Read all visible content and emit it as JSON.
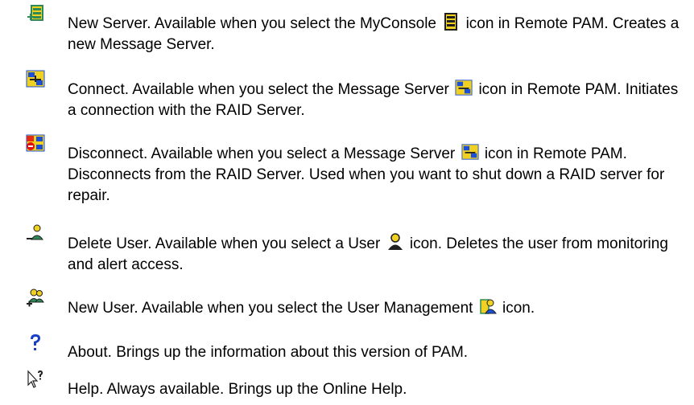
{
  "entries": [
    {
      "icon": "new-server-icon",
      "pre": "New Server. Available when you select the MyConsole",
      "inline_icon": "myconsole-icon",
      "post": "icon in Remote PAM. Creates a new Message Server."
    },
    {
      "icon": "connect-icon",
      "pre": "Connect. Available when you select the Message Server",
      "inline_icon": "message-server-icon",
      "post": "icon in Remote PAM. Initiates a connection with the RAID Server."
    },
    {
      "icon": "disconnect-icon",
      "pre": "Disconnect. Available when you select a Message Server",
      "inline_icon": "message-server-icon",
      "post": "icon in Remote PAM. Disconnects from the RAID Server. Used when you want to shut down a RAID server for repair."
    },
    {
      "icon": "delete-user-icon",
      "pre": "Delete User. Available when you select a User",
      "inline_icon": "user-icon",
      "post": "icon. Deletes the user from monitoring and alert access."
    },
    {
      "icon": "new-user-icon",
      "pre": "New User. Available when you select the User Management",
      "inline_icon": "user-management-icon",
      "post": "icon."
    },
    {
      "icon": "about-icon",
      "text": "About. Brings up the information about this version of PAM."
    },
    {
      "icon": "help-icon",
      "text": "Help. Always available. Brings up the Online Help."
    }
  ],
  "colors": {
    "server_yellow": "#f0d020",
    "server_green": "#2e8b57",
    "server_blue": "#1c4fd8",
    "alert_red": "#e01010",
    "user_black": "#202020",
    "about_blue": "#1a3fc4"
  }
}
